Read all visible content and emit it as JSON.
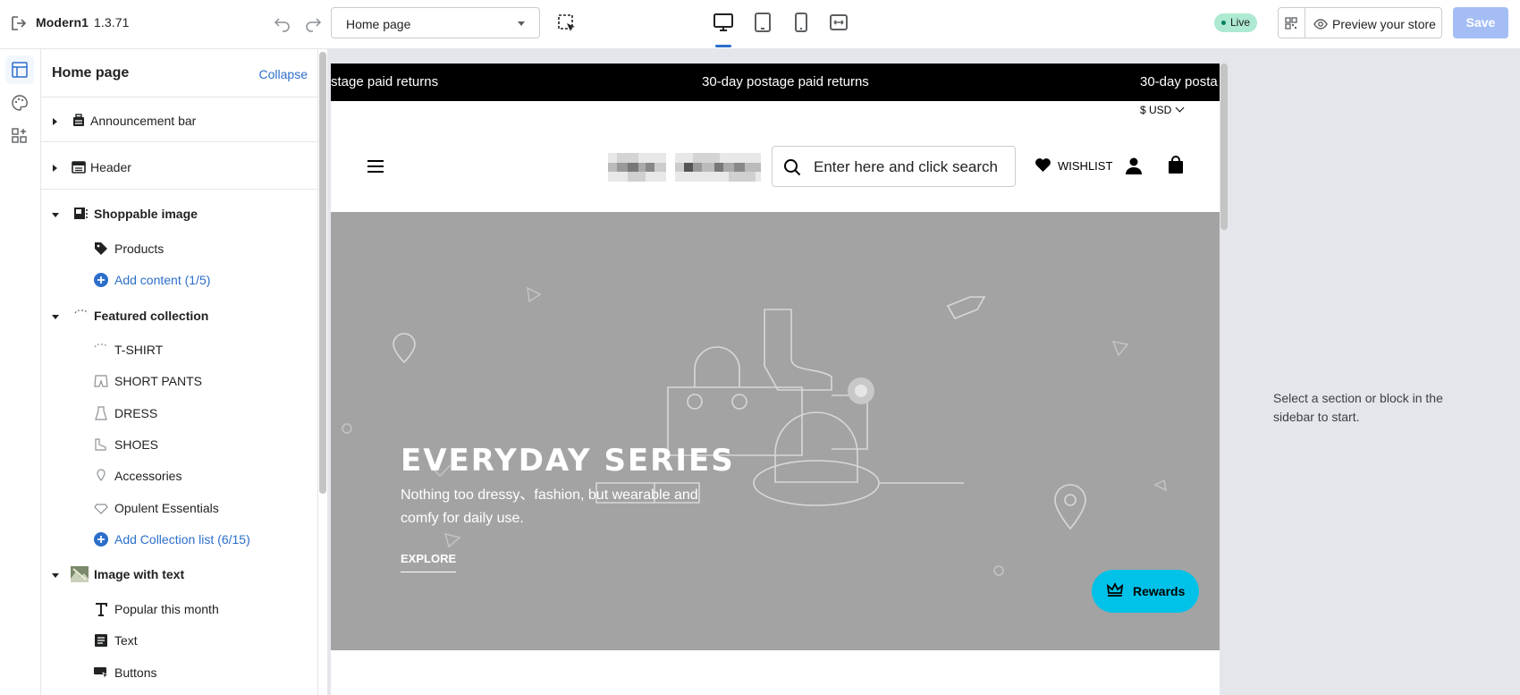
{
  "topbar": {
    "app_name": "Modern1",
    "version": "1.3.71",
    "page_select": "Home page",
    "live_label": "Live",
    "preview_label": "Preview your store",
    "save_label": "Save"
  },
  "sidebar": {
    "title": "Home page",
    "collapse_label": "Collapse",
    "items": [
      {
        "label": "Announcement bar",
        "kind": "section",
        "icon": "announcement-icon"
      },
      {
        "label": "Header",
        "kind": "section",
        "icon": "header-icon"
      },
      {
        "label": "Shoppable image",
        "kind": "section",
        "icon": "shoppable-image-icon"
      },
      {
        "label": "Products",
        "kind": "child",
        "icon": "tag-icon"
      },
      {
        "label": "Add content (1/5)",
        "kind": "add",
        "icon": "add-icon"
      },
      {
        "label": "Featured collection",
        "kind": "section",
        "icon": "collection-icon"
      },
      {
        "label": "T-SHIRT",
        "kind": "child",
        "icon": "tshirt-icon"
      },
      {
        "label": "SHORT PANTS",
        "kind": "child",
        "icon": "pants-icon"
      },
      {
        "label": "DRESS",
        "kind": "child",
        "icon": "dress-icon"
      },
      {
        "label": "SHOES",
        "kind": "child",
        "icon": "shoes-icon"
      },
      {
        "label": "Accessories",
        "kind": "child",
        "icon": "accessories-icon"
      },
      {
        "label": "Opulent Essentials",
        "kind": "child",
        "icon": "gem-icon"
      },
      {
        "label": "Add Collection list (6/15)",
        "kind": "add",
        "icon": "add-icon"
      },
      {
        "label": "Image with text",
        "kind": "section",
        "icon": "image-thumb-icon"
      },
      {
        "label": "Popular this month",
        "kind": "child",
        "icon": "text-t-icon"
      },
      {
        "label": "Text",
        "kind": "child",
        "icon": "text-block-icon"
      },
      {
        "label": "Buttons",
        "kind": "child",
        "icon": "buttons-icon"
      }
    ]
  },
  "preview": {
    "announcement": "30-day postage paid returns",
    "announcement_left": "stage paid returns",
    "announcement_right": "30-day posta",
    "currency": "$ USD",
    "search_placeholder": "Enter here and click search",
    "wishlist_label": "WISHLIST",
    "hero_title": "EVERYDAY SERIES",
    "hero_text": "Nothing too dressy、fashion, but wearable and comfy for daily use.",
    "hero_button": "EXPLORE",
    "rewards_label": "Rewards"
  },
  "right_panel": {
    "hint": "Select a section or block in the sidebar to start."
  },
  "colors": {
    "accent": "#2c6ecb",
    "save_disabled": "#a4bef5",
    "live_badge": "#aee9d1",
    "hero_bg": "#a3a3a3",
    "rewards": "#00c2e8"
  }
}
